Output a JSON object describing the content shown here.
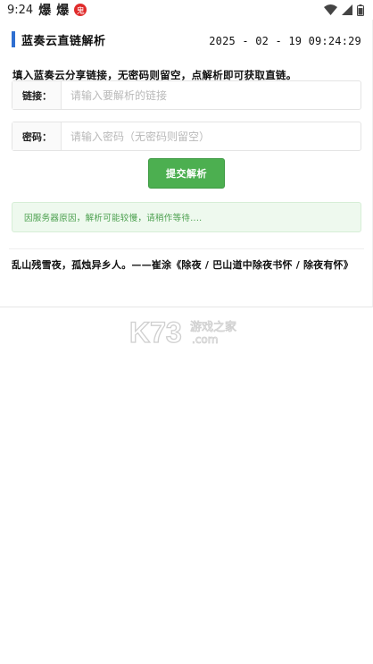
{
  "status_bar": {
    "time": "9:24",
    "app_icon_1": "爆",
    "app_icon_2": "爆",
    "notification_badge": "鬼"
  },
  "header": {
    "title": "蓝奏云直链解析",
    "datetime": "2025 - 02 - 19 09:24:29"
  },
  "form": {
    "hint": "填入蓝奏云分享链接，无密码则留空，点解析即可获取直链。",
    "link_label": "链接：",
    "link_placeholder": "请输入要解析的链接",
    "link_value": "",
    "password_label": "密码：",
    "password_placeholder": "请输入密码（无密码则留空）",
    "password_value": "",
    "submit_label": "提交解析"
  },
  "notice": {
    "text": "因服务器原因，解析可能较慢，请稍作等待...."
  },
  "quote": {
    "text": "乱山残雪夜，孤烛异乡人。——崔涂《除夜 / 巴山道中除夜书怀 / 除夜有怀》"
  },
  "watermark": {
    "brand": "K73",
    "site_cn": "游戏之家",
    "site_en": ".com"
  },
  "icons": {
    "wifi": "wifi-icon",
    "signal": "signal-icon",
    "battery": "battery-icon"
  },
  "colors": {
    "accent_bar": "#2f6fd1",
    "submit_button": "#4caf50",
    "notice_bg": "#eef9ee",
    "notice_text": "#4a9f4d"
  }
}
